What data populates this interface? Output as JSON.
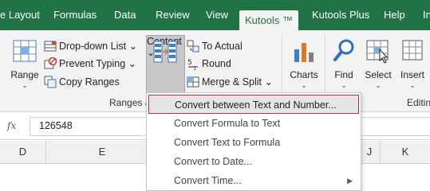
{
  "tabs": [
    {
      "label": "e Layout"
    },
    {
      "label": "Formulas"
    },
    {
      "label": "Data"
    },
    {
      "label": "Review"
    },
    {
      "label": "View"
    },
    {
      "label": "Kutools ™"
    },
    {
      "label": "Kutools Plus"
    },
    {
      "label": "Help"
    },
    {
      "label": "Insert"
    }
  ],
  "ribbon": {
    "range": {
      "label": "Range",
      "chevron": "⌄"
    },
    "small_left": [
      {
        "label": "Drop-down List",
        "chevron": "⌄",
        "icon": "dropdown-list-icon"
      },
      {
        "label": "Prevent Typing",
        "chevron": "⌄",
        "icon": "prevent-typing-icon"
      },
      {
        "label": "Copy Ranges",
        "icon": "copy-ranges-icon"
      }
    ],
    "content": {
      "label": "Content",
      "chevron": "⌄"
    },
    "small_right": [
      {
        "label": "To Actual",
        "icon": "to-actual-icon"
      },
      {
        "label": "Round",
        "icon": "round-icon"
      },
      {
        "label": "Merge & Split",
        "chevron": "⌄",
        "icon": "merge-split-icon"
      }
    ],
    "charts": {
      "label": "Charts",
      "chevron": "⌄"
    },
    "find": {
      "label": "Find",
      "chevron": "⌄"
    },
    "select": {
      "label": "Select",
      "chevron": "⌄"
    },
    "insert": {
      "label": "Insert",
      "chevron": "⌄"
    },
    "group_ranges": "Ranges &",
    "group_editing": "Editin"
  },
  "formula_bar": {
    "fx": "fx",
    "value": "126548"
  },
  "columns": [
    "D",
    "E",
    "J",
    "K"
  ],
  "menu": {
    "items": [
      {
        "label": "Convert between Text and Number..."
      },
      {
        "label": "Convert Formula to Text"
      },
      {
        "label": "Convert Text to Formula"
      },
      {
        "label": "Convert to Date..."
      },
      {
        "label": "Convert Time...",
        "arrow": "▶"
      }
    ]
  },
  "colors": {
    "tab_bar": "#217346",
    "ribbon_bg": "#f3f3f3",
    "highlight_border": "#b0323c"
  }
}
